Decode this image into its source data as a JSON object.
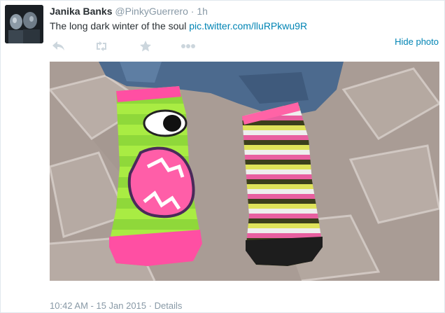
{
  "tweet": {
    "author_name": "Janika Banks",
    "author_handle": "@PinkyGuerrero",
    "separator": "·",
    "time_ago": "1h",
    "text": "The long dark winter of the soul",
    "link_text": "pic.twitter.com/lluRPkwu9R"
  },
  "actions": {
    "reply_icon": "reply-icon",
    "retweet_icon": "retweet-icon",
    "favorite_icon": "star-icon",
    "more_icon": "more-icon",
    "hide_photo_label": "Hide photo"
  },
  "footer": {
    "timestamp": "10:42 AM - 15 Jan 2015",
    "separator": "·",
    "details_label": "Details"
  },
  "colors": {
    "link": "#0084b4",
    "muted": "#8899a6",
    "text": "#292f33"
  }
}
